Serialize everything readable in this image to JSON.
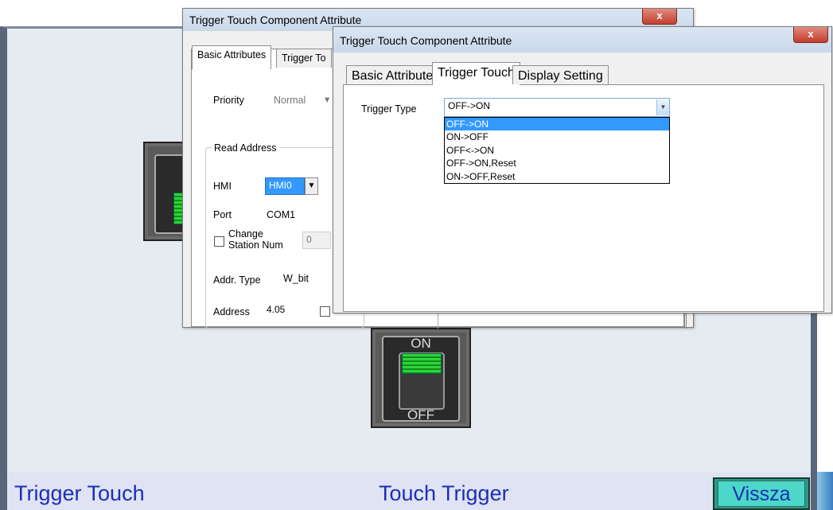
{
  "hmi": {
    "bottom_left_label": "Trigger Touch",
    "bottom_center_label": "Touch Trigger",
    "back_button_label": "Vissza",
    "switch_on_label": "ON",
    "switch_off_label": "OFF"
  },
  "back_window": {
    "title": "Trigger Touch Component Attribute",
    "close_label": "x",
    "tabs": [
      "Basic Attributes",
      "Trigger To"
    ],
    "priority_label": "Priority",
    "priority_value": "Normal",
    "group_label": "Read Address",
    "hmi_label": "HMI",
    "hmi_value": "HMI0",
    "port_label": "Port",
    "port_value": "COM1",
    "change_station_label": "Change\nStation Num",
    "station_value": "0",
    "addr_type_label": "Addr. Type",
    "addr_type_value": "W_bit",
    "address_label": "Address",
    "address_value": "4.05"
  },
  "front_window": {
    "title": "Trigger Touch Component Attribute",
    "close_label": "x",
    "tabs": [
      "Basic Attributes",
      "Trigger Touch",
      "Display Setting"
    ],
    "trigger_type_label": "Trigger Type",
    "trigger_type_value": "OFF->ON",
    "trigger_options": [
      "OFF->ON",
      "ON->OFF",
      "OFF<->ON",
      "OFF->ON,Reset",
      "ON->OFF,Reset"
    ],
    "selected_option_index": 0
  },
  "colors": {
    "selection": "#3399ff",
    "hmi_text": "#1b2fb5",
    "button_face": "#4dd7c8"
  }
}
